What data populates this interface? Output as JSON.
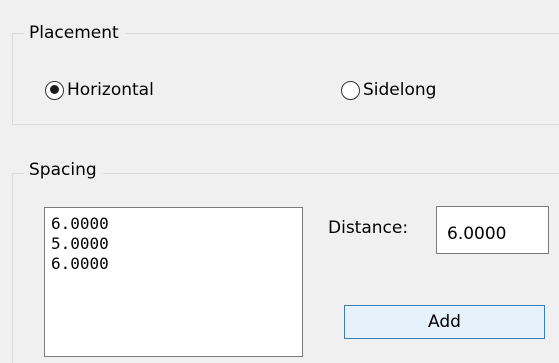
{
  "placement": {
    "title": "Placement",
    "options": [
      {
        "label": "Horizontal",
        "checked": true
      },
      {
        "label": "Sidelong",
        "checked": false
      }
    ]
  },
  "spacing": {
    "title": "Spacing",
    "list_items": [
      "6.0000",
      "5.0000",
      "6.0000"
    ],
    "distance_label": "Distance:",
    "distance_value": "6.0000",
    "add_label": "Add"
  }
}
